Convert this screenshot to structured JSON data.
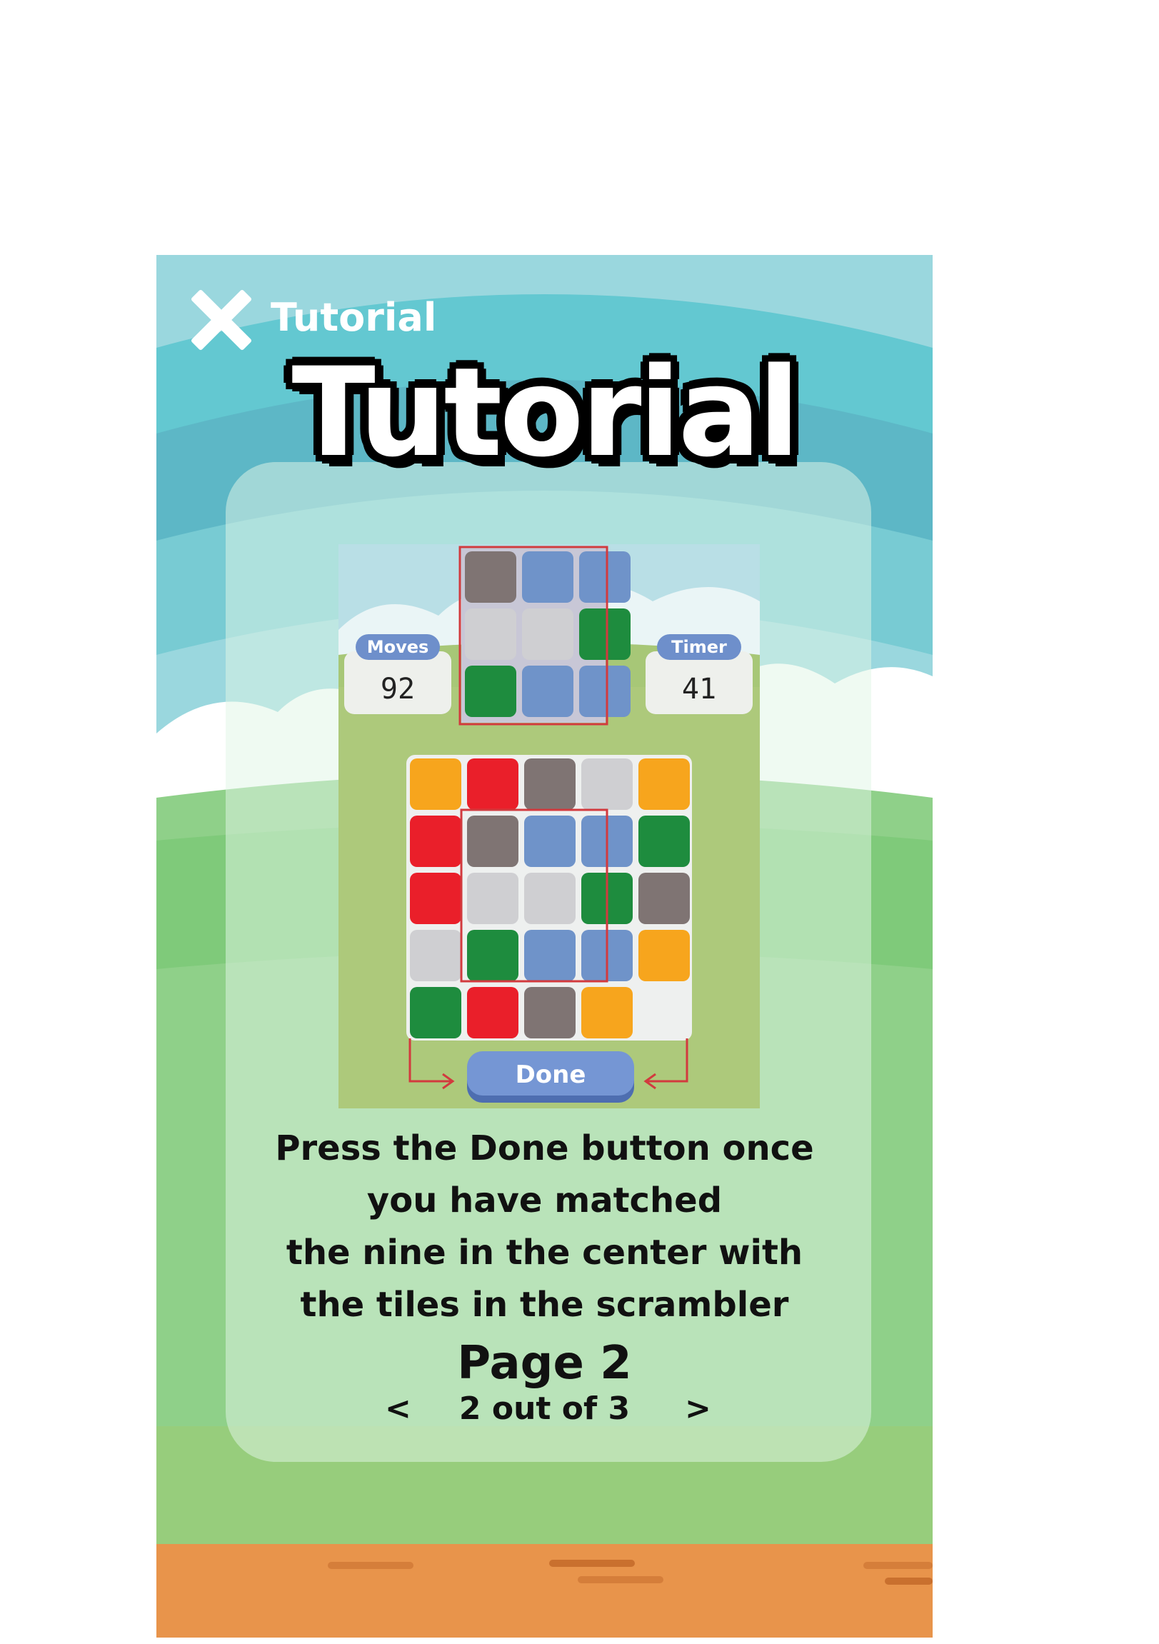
{
  "header": {
    "title": "Tutorial"
  },
  "main_title": "Tutorial",
  "preview": {
    "moves_label": "Moves",
    "moves_value": "92",
    "timer_label": "Timer",
    "timer_value": "41",
    "done_label": "Done",
    "target_grid": [
      [
        "gray",
        "blue",
        "blue"
      ],
      [
        "lightgray",
        "lightgray",
        "green"
      ],
      [
        "green",
        "blue",
        "blue"
      ]
    ],
    "board_grid": [
      [
        "orange",
        "red",
        "gray",
        "lightgray",
        "orange"
      ],
      [
        "red",
        "gray",
        "blue",
        "blue",
        "green"
      ],
      [
        "red",
        "lightgray",
        "lightgray",
        "green",
        "gray"
      ],
      [
        "lightgray",
        "green",
        "blue",
        "blue",
        "orange"
      ],
      [
        "green",
        "red",
        "gray",
        "orange",
        "empty"
      ]
    ],
    "colors": {
      "gray": "#7f7473",
      "blue": "#6f93c9",
      "lightgray": "#cfcfd2",
      "green": "#1e8c3e",
      "red": "#ea1f2a",
      "orange": "#f7a51d",
      "highlight": "#d23a3e"
    }
  },
  "instructions": [
    "Press the Done button once",
    "you have matched",
    "the nine in the center with",
    "the tiles in the scrambler"
  ],
  "page": {
    "title": "Page 2",
    "counter": "2 out of 3",
    "prev": "<",
    "next": ">"
  }
}
